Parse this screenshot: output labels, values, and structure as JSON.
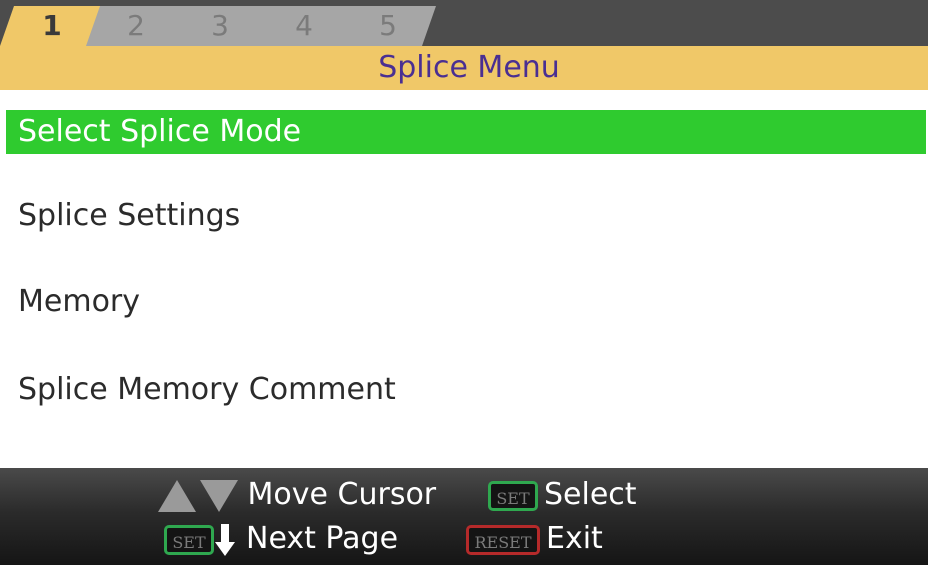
{
  "tabs": [
    {
      "label": "1",
      "active": true
    },
    {
      "label": "2",
      "active": false
    },
    {
      "label": "3",
      "active": false
    },
    {
      "label": "4",
      "active": false
    },
    {
      "label": "5",
      "active": false
    }
  ],
  "title": "Splice Menu",
  "menu": {
    "items": [
      {
        "label": "Select Splice Mode",
        "selected": true
      },
      {
        "label": "Splice Settings",
        "selected": false
      },
      {
        "label": "Memory",
        "selected": false
      },
      {
        "label": "Splice Memory Comment",
        "selected": false
      }
    ]
  },
  "footer": {
    "move_cursor": {
      "label": "Move Cursor",
      "icon": "up-down-arrows-icon"
    },
    "select": {
      "key": "SET",
      "label": "Select"
    },
    "next_page": {
      "key": "SET",
      "label": "Next Page",
      "icon": "down-arrow-icon"
    },
    "exit": {
      "key": "RESET",
      "label": "Exit"
    }
  },
  "colors": {
    "title_band": "#f0c868",
    "title_text": "#4a2f92",
    "tab_inactive": "#a6a6a6",
    "tab_strip": "#4c4c4c",
    "selection": "#2fcb2f",
    "key_green": "#2fa84f",
    "key_red": "#b52a2a"
  }
}
